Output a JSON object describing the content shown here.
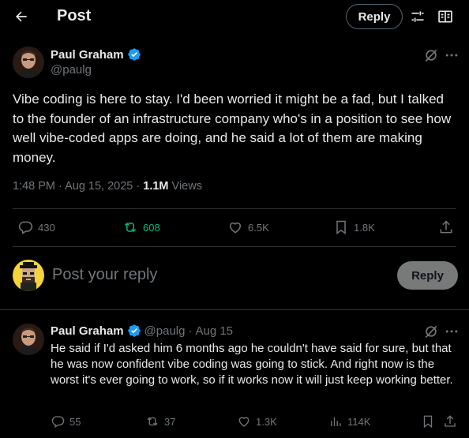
{
  "header": {
    "title": "Post",
    "reply_label": "Reply"
  },
  "tweet": {
    "author_name": "Paul Graham",
    "handle": "@paulg",
    "text": "Vibe coding is here to stay. I'd been worried it might be a fad, but I talked to the founder of an infrastructure company who's in a position to see how well vibe-coded apps are doing, and he said a lot of them are making money.",
    "time": "1:48 PM · Aug 15, 2025 · ",
    "views_count": "1.1M",
    "views_label": " Views",
    "stats": {
      "replies": "430",
      "reposts": "608",
      "likes": "6.5K",
      "bookmarks": "1.8K"
    }
  },
  "compose": {
    "placeholder": "Post your reply",
    "button_label": "Reply"
  },
  "reply": {
    "author_name": "Paul Graham",
    "handle": "@paulg",
    "dot": "·",
    "date": "Aug 15",
    "text": "He said if I'd asked him 6 months ago he couldn't have said for sure, but that he was now confident vibe coding was going to stick. And right now is the worst it's ever going to work, so if it works now it will just keep working better.",
    "stats": {
      "replies": "55",
      "reposts": "37",
      "likes": "1.3K",
      "views": "114K"
    }
  },
  "colors": {
    "background": "#000000",
    "text": "#e7e9ea",
    "muted": "#71767b",
    "verified": "#1d9bf0",
    "repost_active": "#00ba7c",
    "divider": "#2f3336",
    "reply_button_bg": "#787a7a"
  },
  "icons": [
    "back-arrow-icon",
    "adjust-sliders-icon",
    "reader-icon",
    "verified-badge-icon",
    "grok-icon",
    "more-icon",
    "reply-icon",
    "repost-icon",
    "like-icon",
    "bookmark-icon",
    "share-icon",
    "views-icon"
  ]
}
